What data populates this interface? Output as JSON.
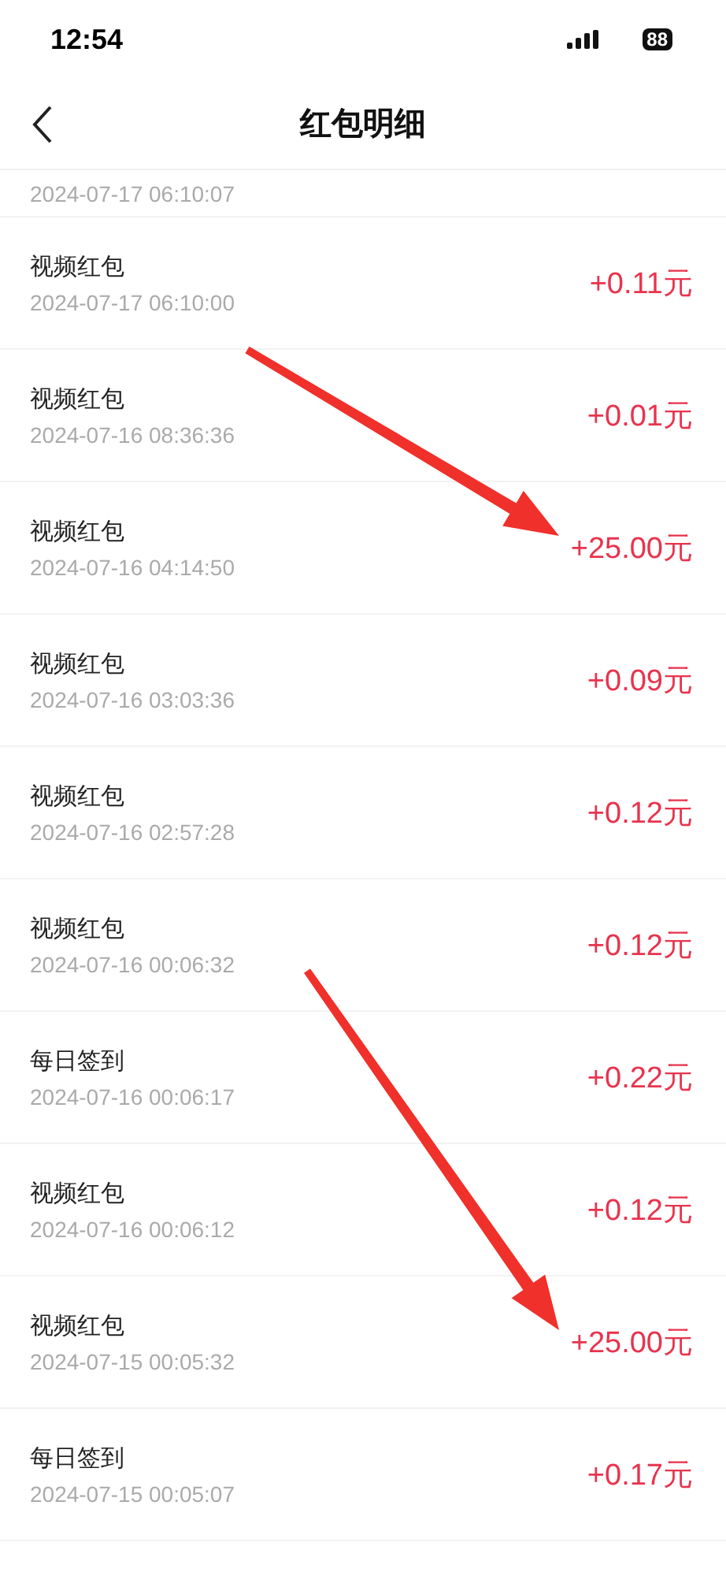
{
  "status_bar": {
    "time": "12:54",
    "battery": "88"
  },
  "header": {
    "title": "红包明细"
  },
  "partial_row": {
    "date": "2024-07-17 06:10:07"
  },
  "rows": [
    {
      "name": "视频红包",
      "date": "2024-07-17 06:10:00",
      "amount": "+0.11元",
      "arrow": false
    },
    {
      "name": "视频红包",
      "date": "2024-07-16 08:36:36",
      "amount": "+0.01元",
      "arrow": false
    },
    {
      "name": "视频红包",
      "date": "2024-07-16 04:14:50",
      "amount": "+25.00元",
      "arrow": true
    },
    {
      "name": "视频红包",
      "date": "2024-07-16 03:03:36",
      "amount": "+0.09元",
      "arrow": false
    },
    {
      "name": "视频红包",
      "date": "2024-07-16 02:57:28",
      "amount": "+0.12元",
      "arrow": false
    },
    {
      "name": "视频红包",
      "date": "2024-07-16 00:06:32",
      "amount": "+0.12元",
      "arrow": false
    },
    {
      "name": "每日签到",
      "date": "2024-07-16 00:06:17",
      "amount": "+0.22元",
      "arrow": false
    },
    {
      "name": "视频红包",
      "date": "2024-07-16 00:06:12",
      "amount": "+0.12元",
      "arrow": false
    },
    {
      "name": "视频红包",
      "date": "2024-07-15 00:05:32",
      "amount": "+25.00元",
      "arrow": true
    },
    {
      "name": "每日签到",
      "date": "2024-07-15 00:05:07",
      "amount": "+0.17元",
      "arrow": false
    }
  ]
}
